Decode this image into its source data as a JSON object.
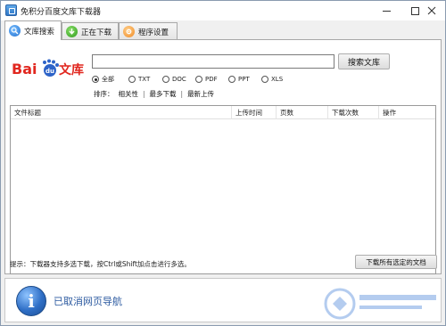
{
  "window": {
    "title": "免积分百度文库下载器"
  },
  "tabs": [
    {
      "label": "文库搜索",
      "icon": "magnifier-icon",
      "active": true
    },
    {
      "label": "正在下载",
      "icon": "download-arrow-icon",
      "active": false
    },
    {
      "label": "程序设置",
      "icon": "settings-icon",
      "active": false
    }
  ],
  "logo": {
    "brand_left": "Bai",
    "brand_paw": "du",
    "brand_right": "文库"
  },
  "search": {
    "value": "",
    "placeholder": "",
    "button_label": "搜索文库"
  },
  "filters": [
    {
      "label": "全部",
      "selected": true
    },
    {
      "label": "TXT",
      "selected": false
    },
    {
      "label": "DOC",
      "selected": false
    },
    {
      "label": "PDF",
      "selected": false
    },
    {
      "label": "PPT",
      "selected": false
    },
    {
      "label": "XLS",
      "selected": false
    }
  ],
  "sort": {
    "label": "排序：",
    "options": [
      "相关性",
      "最多下载",
      "最新上传"
    ],
    "separator": "|"
  },
  "table": {
    "columns": [
      "文件标题",
      "上传时间",
      "页数",
      "下载次数",
      "操作"
    ],
    "rows": []
  },
  "footer": {
    "hint": "提示：下载器支持多选下载，按Ctrl或Shift加点击进行多选。",
    "download_selected_label": "下载所有选定的文档"
  },
  "info": {
    "message": "已取消网页导航"
  },
  "colors": {
    "baidu_red": "#e1271f",
    "baidu_blue": "#2d63c8",
    "info_text": "#2c5aa0"
  }
}
